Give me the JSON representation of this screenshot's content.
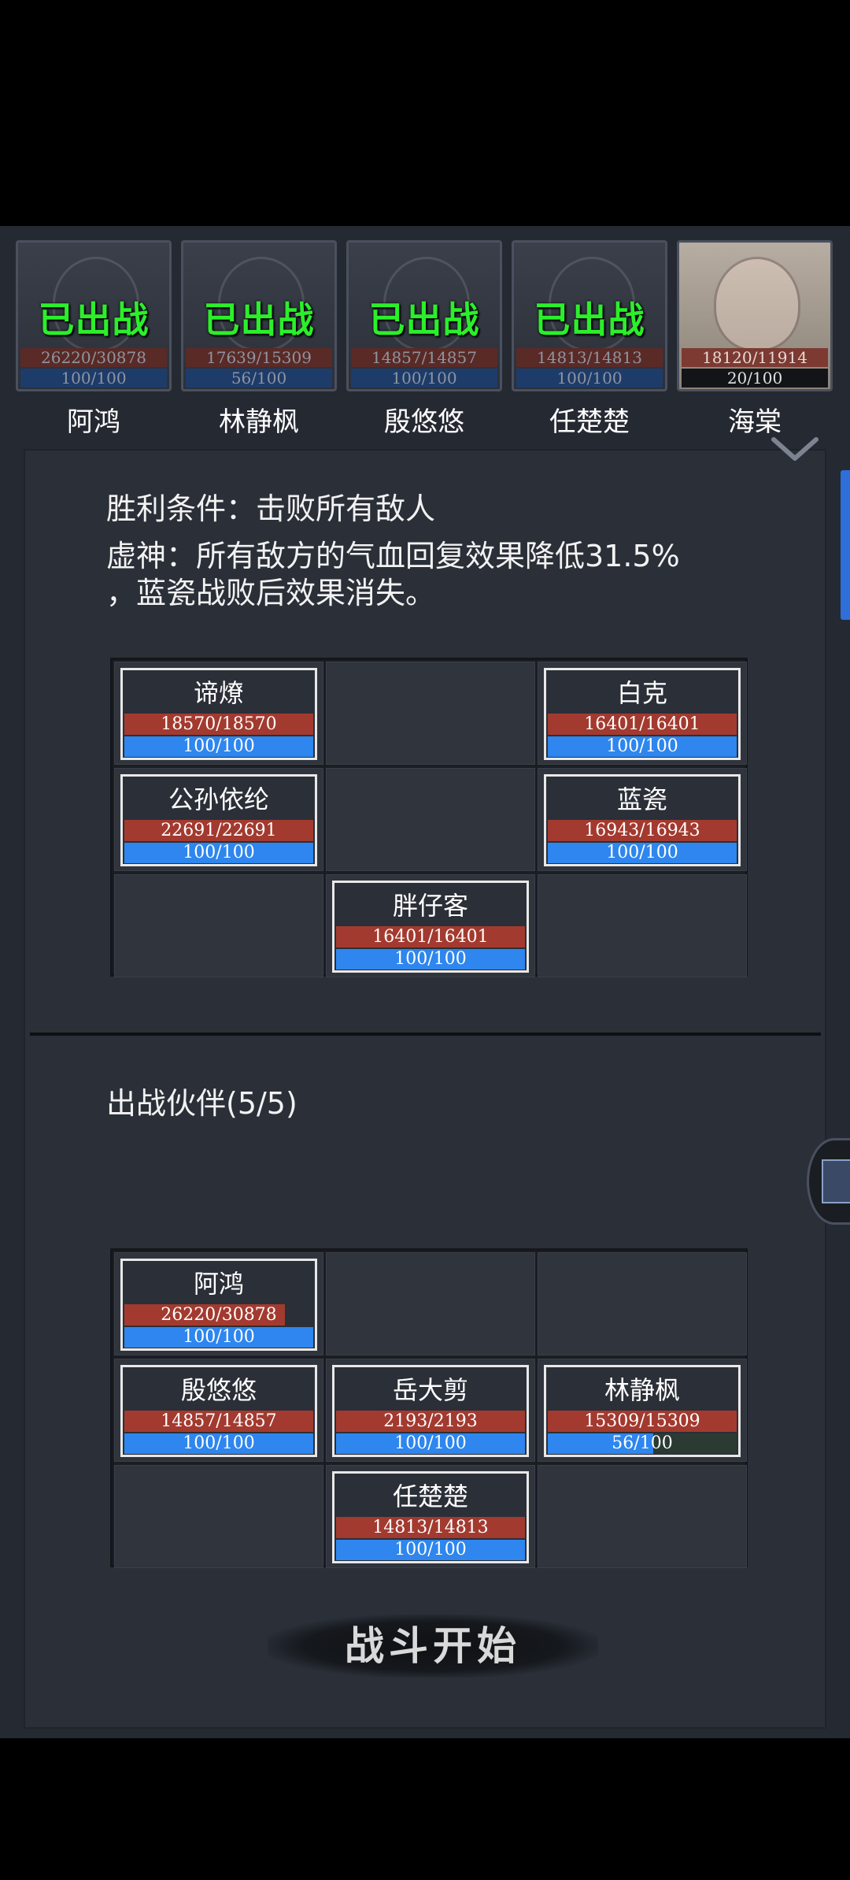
{
  "roster": [
    {
      "name": "阿鸿",
      "status": "已出战",
      "hp": "26220/30878",
      "mp": "100/100"
    },
    {
      "name": "林静枫",
      "status": "已出战",
      "hp": "17639/15309",
      "mp": "56/100"
    },
    {
      "name": "殷悠悠",
      "status": "已出战",
      "hp": "14857/14857",
      "mp": "100/100"
    },
    {
      "name": "任楚楚",
      "status": "已出战",
      "hp": "14813/14813",
      "mp": "100/100"
    },
    {
      "name": "海棠",
      "status": "",
      "hp": "18120/11914",
      "mp": "20/100"
    }
  ],
  "conditions": {
    "victory": "胜利条件：击败所有敌人",
    "effect_line1": "虚神：所有敌方的气血回复效果降低31.5%",
    "effect_line2": "，蓝瓷战败后效果消失。"
  },
  "enemies": [
    {
      "name": "谛燎",
      "hp": "18570/18570",
      "mp": "100/100",
      "hp_fraction": 1.0,
      "mp_fraction": 1.0
    },
    {
      "name": "白克",
      "hp": "16401/16401",
      "mp": "100/100",
      "hp_fraction": 1.0,
      "mp_fraction": 1.0
    },
    {
      "name": "公孙依纶",
      "hp": "22691/22691",
      "mp": "100/100",
      "hp_fraction": 1.0,
      "mp_fraction": 1.0
    },
    {
      "name": "蓝瓷",
      "hp": "16943/16943",
      "mp": "100/100",
      "hp_fraction": 1.0,
      "mp_fraction": 1.0
    },
    {
      "name": "胖仔客",
      "hp": "16401/16401",
      "mp": "100/100",
      "hp_fraction": 1.0,
      "mp_fraction": 1.0
    }
  ],
  "party": {
    "title": "出战伙伴(5/5)",
    "members": [
      {
        "name": "阿鸿",
        "hp": "26220/30878",
        "mp": "100/100",
        "hp_fraction": 0.849,
        "mp_fraction": 1.0
      },
      {
        "name": "殷悠悠",
        "hp": "14857/14857",
        "mp": "100/100",
        "hp_fraction": 1.0,
        "mp_fraction": 1.0
      },
      {
        "name": "岳大剪",
        "hp": "2193/2193",
        "mp": "100/100",
        "hp_fraction": 1.0,
        "mp_fraction": 1.0
      },
      {
        "name": "林静枫",
        "hp": "15309/15309",
        "mp": "56/100",
        "hp_fraction": 1.0,
        "mp_fraction": 0.56
      },
      {
        "name": "任楚楚",
        "hp": "14813/14813",
        "mp": "100/100",
        "hp_fraction": 1.0,
        "mp_fraction": 1.0
      }
    ]
  },
  "start_button": "战斗开始",
  "colors": {
    "deployed_text": "#2bef2b",
    "hp_bar": "#a33a2f",
    "mp_bar": "#2e86ee",
    "background": "#252932"
  }
}
